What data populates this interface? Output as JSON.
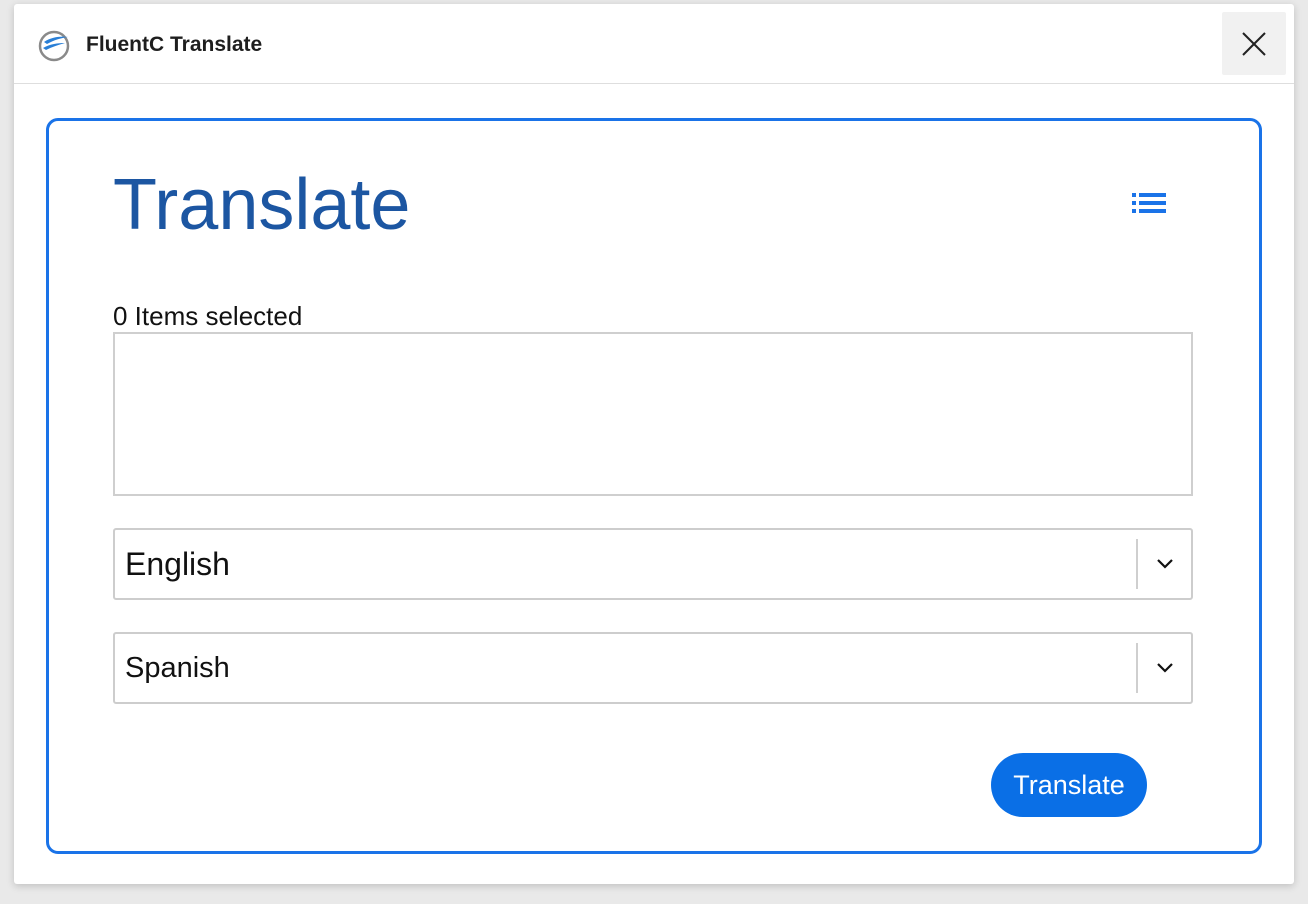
{
  "window": {
    "title": "FluentC Translate",
    "logo_icon": "fluentc-logo-icon",
    "close_icon": "close-icon"
  },
  "panel": {
    "heading": "Translate",
    "menu_icon": "list-icon",
    "items_label": "0 Items selected",
    "items": [],
    "source_language": {
      "selected": "English",
      "icon": "chevron-down-icon"
    },
    "target_language": {
      "selected": "Spanish",
      "icon": "chevron-down-icon"
    },
    "translate_button": "Translate"
  },
  "colors": {
    "accent": "#1a73e8",
    "heading": "#1c56a2",
    "button": "#0a6fe6"
  }
}
